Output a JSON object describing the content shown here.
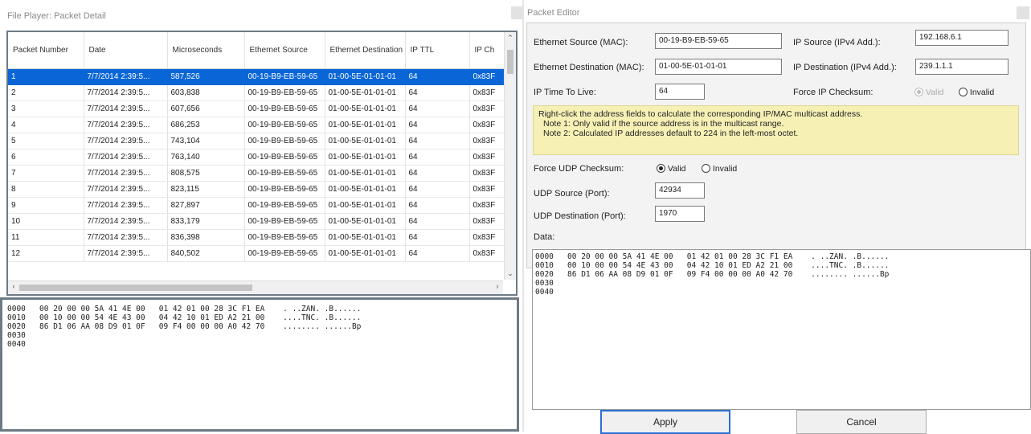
{
  "left": {
    "title": "File Player: Packet Detail",
    "columns": [
      "Packet Number",
      "Date",
      "Microseconds",
      "Ethernet Source",
      "Ethernet Destination",
      "IP TTL",
      "IP Ch"
    ],
    "rows": [
      [
        "1",
        "7/7/2014 2:39:5...",
        "587,526",
        "00-19-B9-EB-59-65",
        "01-00-5E-01-01-01",
        "64",
        "0x83F"
      ],
      [
        "2",
        "7/7/2014 2:39:5...",
        "603,838",
        "00-19-B9-EB-59-65",
        "01-00-5E-01-01-01",
        "64",
        "0x83F"
      ],
      [
        "3",
        "7/7/2014 2:39:5...",
        "607,656",
        "00-19-B9-EB-59-65",
        "01-00-5E-01-01-01",
        "64",
        "0x83F"
      ],
      [
        "4",
        "7/7/2014 2:39:5...",
        "686,253",
        "00-19-B9-EB-59-65",
        "01-00-5E-01-01-01",
        "64",
        "0x83F"
      ],
      [
        "5",
        "7/7/2014 2:39:5...",
        "743,104",
        "00-19-B9-EB-59-65",
        "01-00-5E-01-01-01",
        "64",
        "0x83F"
      ],
      [
        "6",
        "7/7/2014 2:39:5...",
        "763,140",
        "00-19-B9-EB-59-65",
        "01-00-5E-01-01-01",
        "64",
        "0x83F"
      ],
      [
        "7",
        "7/7/2014 2:39:5...",
        "808,575",
        "00-19-B9-EB-59-65",
        "01-00-5E-01-01-01",
        "64",
        "0x83F"
      ],
      [
        "8",
        "7/7/2014 2:39:5...",
        "823,115",
        "00-19-B9-EB-59-65",
        "01-00-5E-01-01-01",
        "64",
        "0x83F"
      ],
      [
        "9",
        "7/7/2014 2:39:5...",
        "827,897",
        "00-19-B9-EB-59-65",
        "01-00-5E-01-01-01",
        "64",
        "0x83F"
      ],
      [
        "10",
        "7/7/2014 2:39:5...",
        "833,179",
        "00-19-B9-EB-59-65",
        "01-00-5E-01-01-01",
        "64",
        "0x83F"
      ],
      [
        "11",
        "7/7/2014 2:39:5...",
        "836,398",
        "00-19-B9-EB-59-65",
        "01-00-5E-01-01-01",
        "64",
        "0x83F"
      ],
      [
        "12",
        "7/7/2014 2:39:5...",
        "840,502",
        "00-19-B9-EB-59-65",
        "01-00-5E-01-01-01",
        "64",
        "0x83F"
      ]
    ],
    "selected_row": 0,
    "hex": "0000   00 20 00 00 5A 41 4E 00   01 42 01 00 28 3C F1 EA    . ..ZAN. .B......\n0010   00 10 00 00 54 4E 43 00   04 42 10 01 ED A2 21 00    ....TNC. .B......\n0020   86 D1 06 AA 08 D9 01 0F   09 F4 00 00 00 A0 42 70    ........ ......Bp\n0030\n0040"
  },
  "editor": {
    "title": "Packet Editor",
    "eth_src_label": "Ethernet Source (MAC):",
    "eth_src": "00-19-B9-EB-59-65",
    "eth_dst_label": "Ethernet Destination (MAC):",
    "eth_dst": "01-00-5E-01-01-01",
    "ttl_label": "IP Time To Live:",
    "ttl": "64",
    "ip_src_label": "IP Source (IPv4 Add.):",
    "ip_src": "192.168.6.1",
    "ip_dst_label": "IP Destination (IPv4 Add.):",
    "ip_dst": "239.1.1.1",
    "force_ip_label": "Force IP Checksum:",
    "valid_label": "Valid",
    "invalid_label": "Invalid",
    "info_line1": "Right-click the address fields to calculate the corresponding IP/MAC multicast address.",
    "info_line2": "Note 1: Only valid if the source address is in the multicast range.",
    "info_line3": "Note 2: Calculated IP addresses default to 224 in the left-most octet.",
    "force_udp_label": "Force UDP Checksum:",
    "udp_src_label": "UDP Source (Port):",
    "udp_src": "42934",
    "udp_dst_label": "UDP Destination (Port):",
    "udp_dst": "1970",
    "data_label": "Data:",
    "hex": "0000   00 20 00 00 5A 41 4E 00   01 42 01 00 28 3C F1 EA    . ..ZAN. .B......\n0010   00 10 00 00 54 4E 43 00   04 42 10 01 ED A2 21 00    ....TNC. .B......\n0020   86 D1 06 AA 08 D9 01 0F   09 F4 00 00 00 A0 42 70    ........ ......Bp\n0030\n0040",
    "apply_label": "Apply",
    "cancel_label": "Cancel"
  },
  "icons": {
    "scroll_up": "chevron-up-icon",
    "scroll_down": "chevron-down-icon",
    "scroll_left": "chevron-left-icon",
    "scroll_right": "chevron-right-icon"
  },
  "colors": {
    "selection": "#0a66d6",
    "info_bg": "#f6f0b5",
    "apply_border": "#2a6fd1"
  }
}
